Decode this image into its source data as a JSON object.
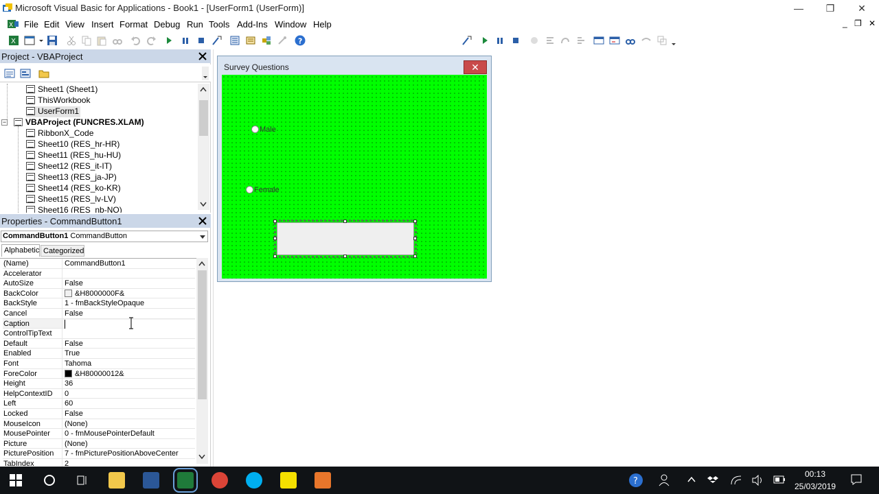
{
  "window": {
    "title": "Microsoft Visual Basic for Applications - Book1 - [UserForm1 (UserForm)]",
    "minimize": "—",
    "restore": "❐",
    "close": "✕"
  },
  "menu": [
    "File",
    "Edit",
    "View",
    "Insert",
    "Format",
    "Debug",
    "Run",
    "Tools",
    "Add-Ins",
    "Window",
    "Help"
  ],
  "mdi": {
    "min": "_",
    "restore": "❐",
    "close": "✕"
  },
  "project": {
    "title": "Project - VBAProject",
    "items": [
      {
        "label": "Sheet1 (Sheet1)",
        "kind": "sheet",
        "indent": 2
      },
      {
        "label": "ThisWorkbook",
        "kind": "workbook",
        "indent": 2
      },
      {
        "label": "UserForm1",
        "kind": "form",
        "indent": 2
      },
      {
        "label": "VBAProject (FUNCRES.XLAM)",
        "kind": "project",
        "indent": 1,
        "bold": true
      },
      {
        "label": "RibbonX_Code",
        "kind": "workbook",
        "indent": 2
      },
      {
        "label": "Sheet10 (RES_hr-HR)",
        "kind": "sheet",
        "indent": 2
      },
      {
        "label": "Sheet11 (RES_hu-HU)",
        "kind": "sheet",
        "indent": 2
      },
      {
        "label": "Sheet12 (RES_it-IT)",
        "kind": "sheet",
        "indent": 2
      },
      {
        "label": "Sheet13 (RES_ja-JP)",
        "kind": "sheet",
        "indent": 2
      },
      {
        "label": "Sheet14 (RES_ko-KR)",
        "kind": "sheet",
        "indent": 2
      },
      {
        "label": "Sheet15 (RES_lv-LV)",
        "kind": "sheet",
        "indent": 2
      },
      {
        "label": "Sheet16 (RES_nb-NO)",
        "kind": "sheet",
        "indent": 2
      }
    ]
  },
  "properties": {
    "title": "Properties - CommandButton1",
    "object_name": "CommandButton1",
    "object_type": "CommandButton",
    "tabs": [
      "Alphabetic",
      "Categorized"
    ],
    "rows": [
      {
        "name": "(Name)",
        "value": "CommandButton1"
      },
      {
        "name": "Accelerator",
        "value": ""
      },
      {
        "name": "AutoSize",
        "value": "False"
      },
      {
        "name": "BackColor",
        "value": "&H8000000F&",
        "swatch": "#f0f0f0"
      },
      {
        "name": "BackStyle",
        "value": "1 - fmBackStyleOpaque"
      },
      {
        "name": "Cancel",
        "value": "False"
      },
      {
        "name": "Caption",
        "value": ""
      },
      {
        "name": "ControlTipText",
        "value": ""
      },
      {
        "name": "Default",
        "value": "False"
      },
      {
        "name": "Enabled",
        "value": "True"
      },
      {
        "name": "Font",
        "value": "Tahoma"
      },
      {
        "name": "ForeColor",
        "value": "&H80000012&",
        "swatch": "#000000"
      },
      {
        "name": "Height",
        "value": "36"
      },
      {
        "name": "HelpContextID",
        "value": "0"
      },
      {
        "name": "Left",
        "value": "60"
      },
      {
        "name": "Locked",
        "value": "False"
      },
      {
        "name": "MouseIcon",
        "value": "(None)"
      },
      {
        "name": "MousePointer",
        "value": "0 - fmMousePointerDefault"
      },
      {
        "name": "Picture",
        "value": "(None)"
      },
      {
        "name": "PicturePosition",
        "value": "7 - fmPicturePositionAboveCenter"
      },
      {
        "name": "TabIndex",
        "value": "2"
      }
    ]
  },
  "userform": {
    "caption": "Survey Questions",
    "close": "✕",
    "background": "#00ff00",
    "option_male": "Male",
    "option_female": "Female"
  },
  "taskbar": {
    "time": "00:13",
    "date": "25/03/2019"
  },
  "colors": {
    "accent": "#cbd7e8",
    "form_bg": "#00ff00",
    "taskbar": "#101316"
  }
}
